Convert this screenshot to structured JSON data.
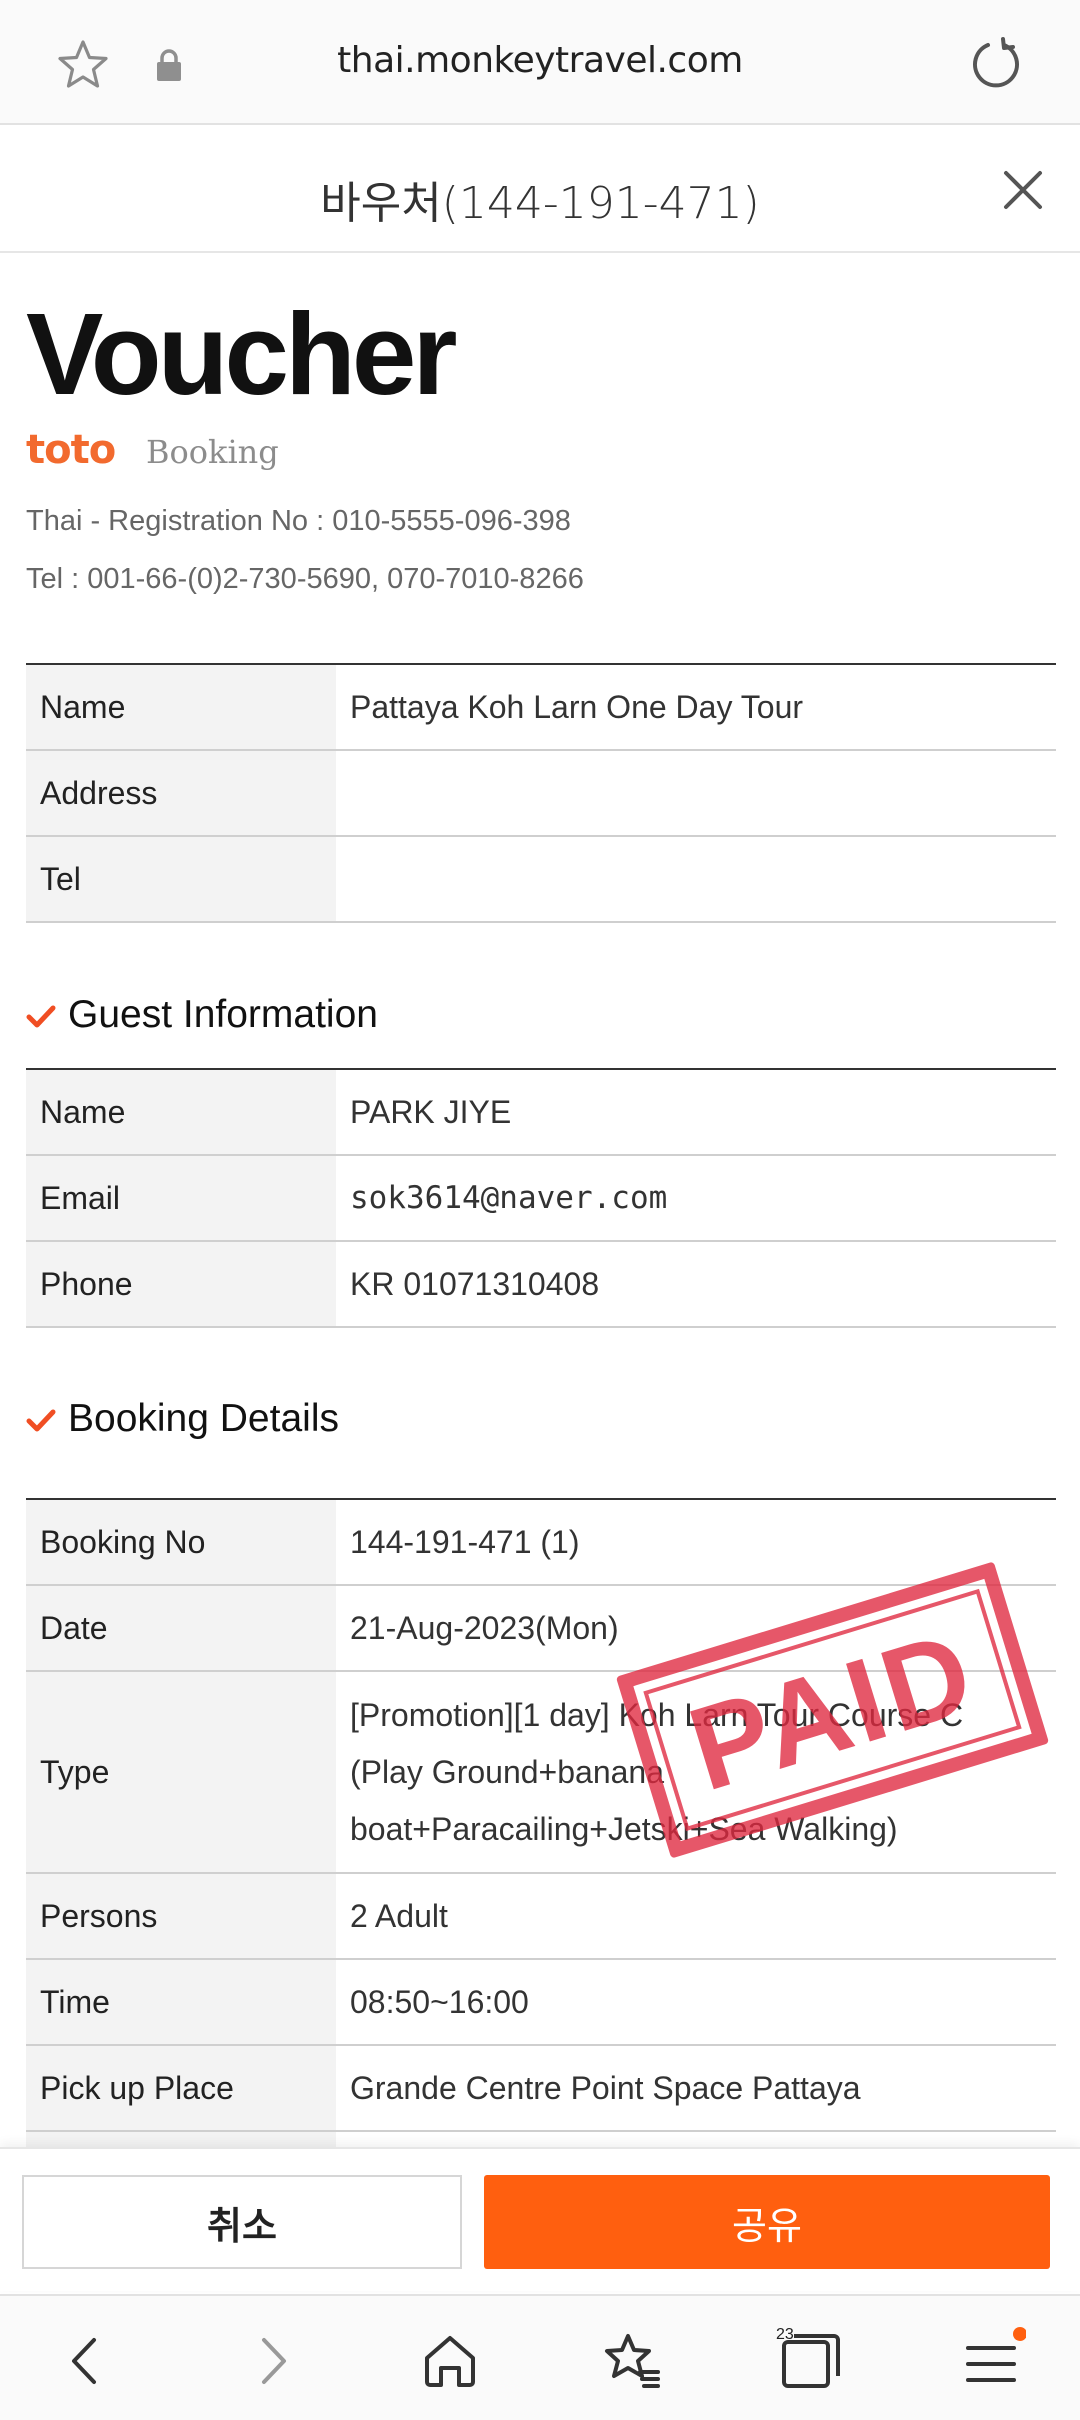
{
  "browser": {
    "url": "thai.monkeytravel.com",
    "tab_count": "23"
  },
  "modal": {
    "title": "바우처(144-191-471)"
  },
  "voucher": {
    "heading": "Voucher",
    "logo_text": "toto Booking",
    "registration": "Thai - Registration No : 010-5555-096-398",
    "tel": "Tel : 001-66-(0)2-730-5690, 070-7010-8266"
  },
  "product": {
    "rows": [
      {
        "label": "Name",
        "value": "Pattaya Koh Larn One Day Tour"
      },
      {
        "label": "Address",
        "value": ""
      },
      {
        "label": "Tel",
        "value": ""
      }
    ]
  },
  "guest": {
    "section_title": "Guest Information",
    "rows": [
      {
        "label": "Name",
        "value": "PARK JIYE"
      },
      {
        "label": "Email",
        "value": "sok3614@naver.com"
      },
      {
        "label": "Phone",
        "value": "KR 01071310408"
      }
    ]
  },
  "booking": {
    "section_title": "Booking Details",
    "rows": [
      {
        "label": "Booking No",
        "value": "144-191-471 (1)"
      },
      {
        "label": "Date",
        "value": "21-Aug-2023(Mon)"
      },
      {
        "label": "Type",
        "value": "[Promotion][1 day] Koh Larn Tour Course C (Play Ground+banana boat+Paracailing+Jetski+Sea Walking)"
      },
      {
        "label": "Persons",
        "value": "2 Adult"
      },
      {
        "label": "Time",
        "value": "08:50~16:00"
      },
      {
        "label": "Pick up Place",
        "value": "Grande Centre Point Space Pattaya"
      }
    ]
  },
  "stamp": {
    "text": "PAID",
    "color": "#e0283f"
  },
  "actions": {
    "cancel_label": "취소",
    "share_label": "공유",
    "share_color": "#ff5f0f"
  },
  "navbar": {
    "items": [
      "back-icon",
      "forward-icon",
      "home-icon",
      "bookmarks-icon",
      "tabs-icon",
      "menu-icon"
    ]
  }
}
